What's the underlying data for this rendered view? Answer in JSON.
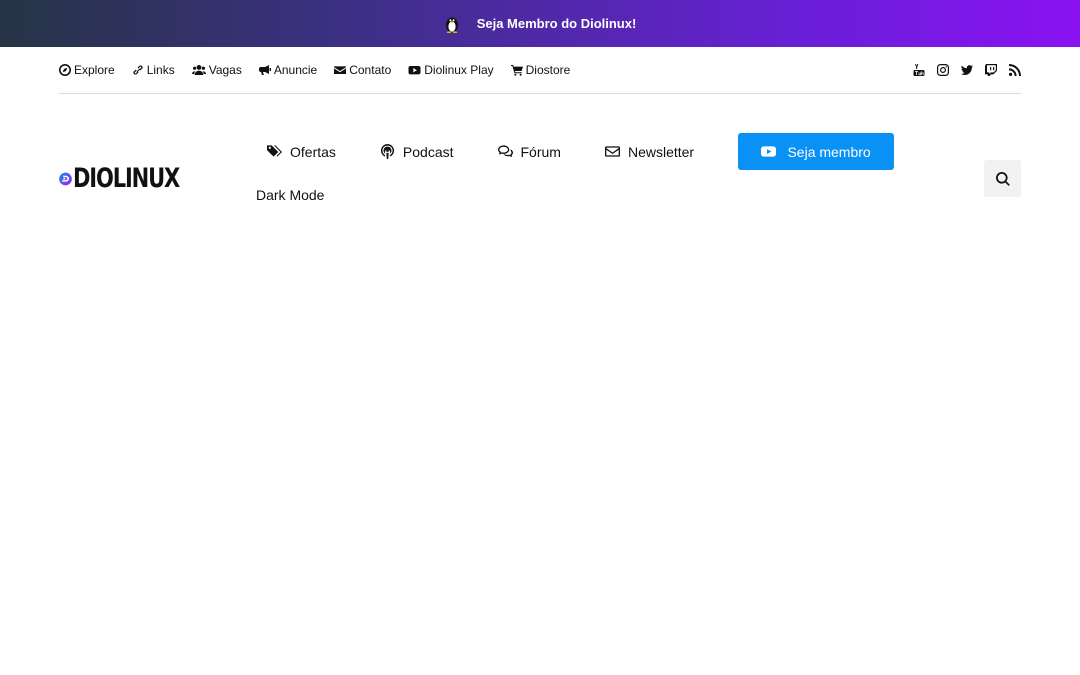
{
  "announcement": {
    "text": "Seja Membro do Diolinux!"
  },
  "top_links": [
    {
      "label": "Explore",
      "icon": "compass-icon"
    },
    {
      "label": "Links",
      "icon": "link-icon"
    },
    {
      "label": "Vagas",
      "icon": "users-icon"
    },
    {
      "label": "Anuncie",
      "icon": "bullhorn-icon"
    },
    {
      "label": "Contato",
      "icon": "envelope-icon"
    },
    {
      "label": "Diolinux Play",
      "icon": "youtube-icon"
    },
    {
      "label": "Diostore",
      "icon": "cart-icon"
    }
  ],
  "social": [
    "youtube-icon",
    "instagram-icon",
    "twitter-icon",
    "twitch-icon",
    "rss-icon"
  ],
  "logo": {
    "text": "DIOLINUX",
    "brand_color": "#0a91f5",
    "accent_color": "#8a12f2"
  },
  "main_nav": [
    {
      "label": "Ofertas",
      "icon": "tags-icon"
    },
    {
      "label": "Podcast",
      "icon": "podcast-icon"
    },
    {
      "label": "Fórum",
      "icon": "comments-icon"
    },
    {
      "label": "Newsletter",
      "icon": "envelope-outline-icon"
    }
  ],
  "cta": {
    "label": "Seja membro",
    "icon": "youtube-icon",
    "color": "#0a91f5"
  },
  "dark_mode": {
    "label": "Dark Mode"
  },
  "search": {
    "icon": "search-icon"
  }
}
